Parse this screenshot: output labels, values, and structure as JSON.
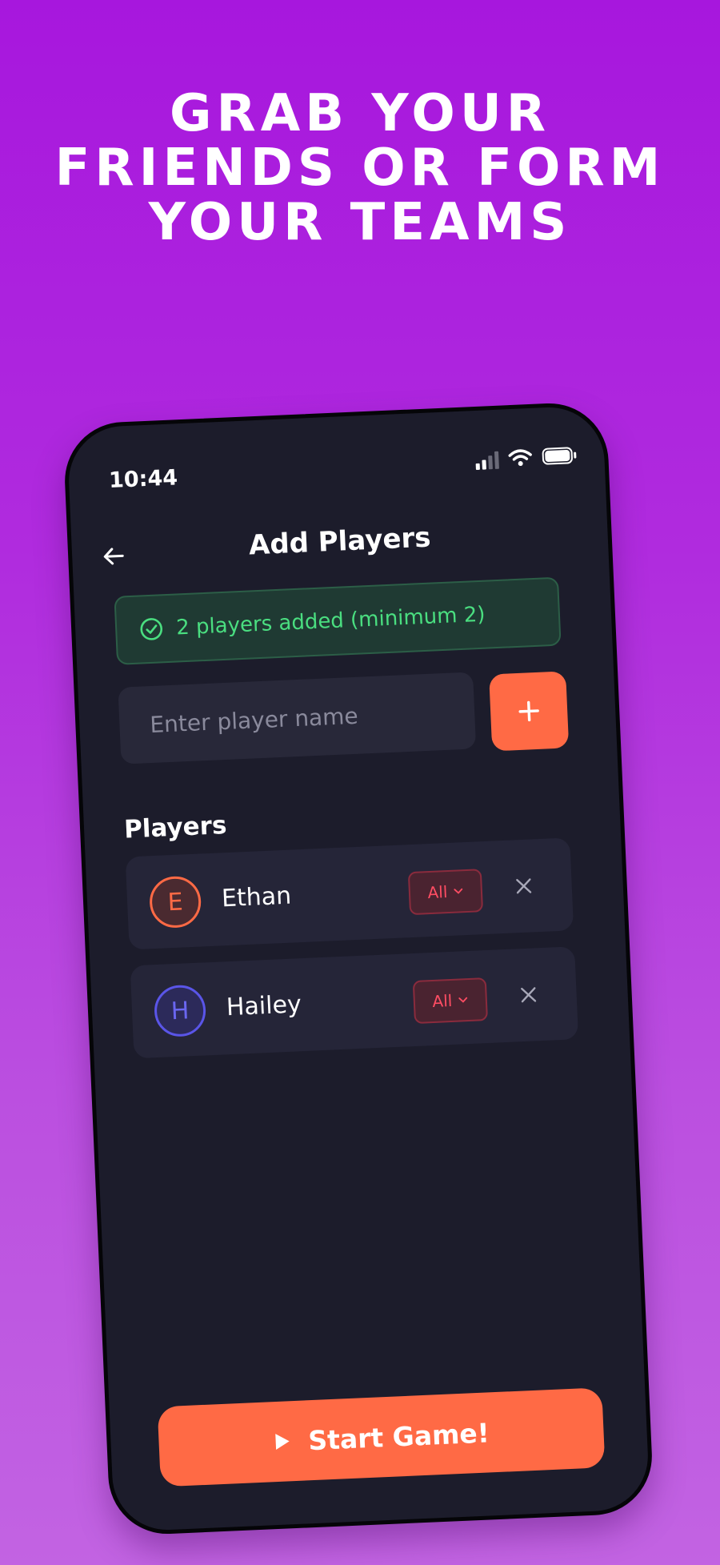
{
  "headline": {
    "lines": [
      "GRAB YOUR",
      "FRIENDS OR FORM",
      "YOUR TEAMS"
    ]
  },
  "status_bar": {
    "time": "10:44",
    "icons": [
      "cellular-signal-icon",
      "wifi-icon",
      "battery-icon"
    ]
  },
  "header": {
    "title": "Add Players",
    "back_icon": "arrow-left-icon"
  },
  "banner": {
    "text": "2 players added (minimum 2)",
    "icon": "check-circle-icon",
    "color": "#4ade80"
  },
  "input": {
    "placeholder": "Enter player name",
    "value": ""
  },
  "add_button": {
    "icon": "plus-icon"
  },
  "players_section": {
    "title": "Players",
    "players": [
      {
        "initial": "E",
        "name": "Ethan",
        "team": "All",
        "color": "#ff6a45"
      },
      {
        "initial": "H",
        "name": "Hailey",
        "team": "All",
        "color": "#5a55e8"
      }
    ]
  },
  "start_button": {
    "label": "Start Game!",
    "icon": "play-icon"
  },
  "colors": {
    "accent": "#ff6a45",
    "background_top": "#a717dd",
    "background_bottom": "#c263e2",
    "phone_surface": "#1c1c2b",
    "danger": "#ff4d63"
  }
}
